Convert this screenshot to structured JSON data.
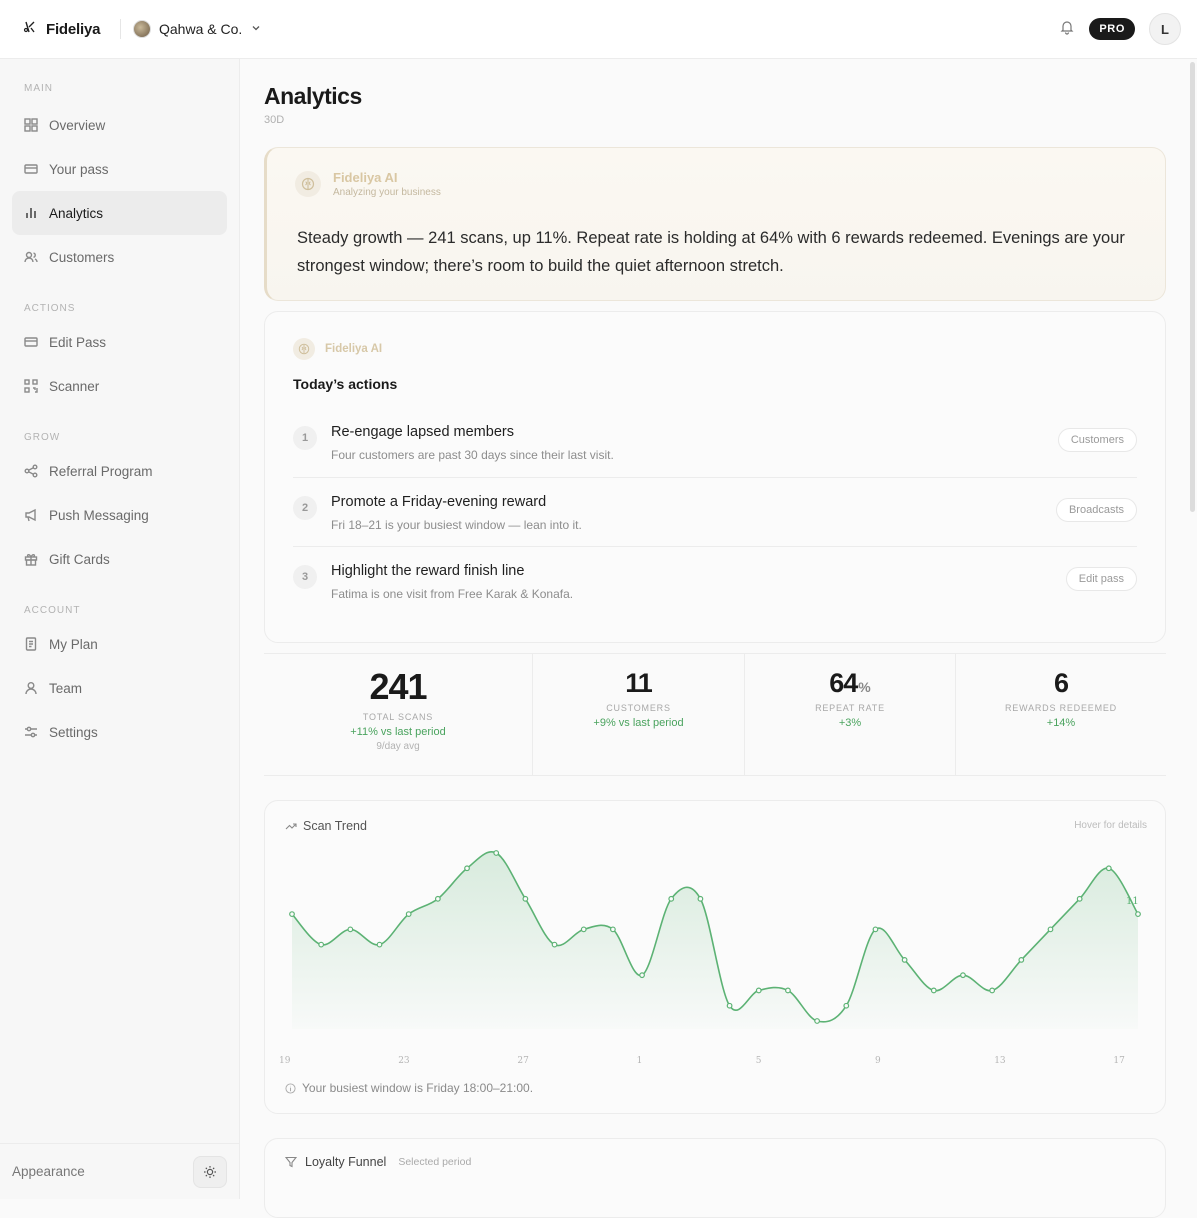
{
  "brand": {
    "name": "Fideliya",
    "org": "Qahwa & Co.",
    "plan_badge": "PRO",
    "user_initial": "L"
  },
  "sidebar": {
    "sections": [
      {
        "label": "MAIN",
        "items": [
          {
            "label": "Overview",
            "icon": "grid-icon"
          },
          {
            "label": "Your pass",
            "icon": "card-icon"
          },
          {
            "label": "Analytics",
            "icon": "bar-chart-icon",
            "active": true
          },
          {
            "label": "Customers",
            "icon": "users-icon"
          }
        ]
      },
      {
        "label": "ACTIONS",
        "items": [
          {
            "label": "Edit Pass",
            "icon": "card-icon"
          },
          {
            "label": "Scanner",
            "icon": "qr-icon"
          }
        ]
      },
      {
        "label": "GROW",
        "items": [
          {
            "label": "Referral Program",
            "icon": "share-icon"
          },
          {
            "label": "Push Messaging",
            "icon": "megaphone-icon"
          },
          {
            "label": "Gift Cards",
            "icon": "gift-icon"
          }
        ]
      },
      {
        "label": "ACCOUNT",
        "items": [
          {
            "label": "My Plan",
            "icon": "receipt-icon"
          },
          {
            "label": "Team",
            "icon": "user-icon"
          },
          {
            "label": "Settings",
            "icon": "sliders-icon"
          }
        ]
      }
    ],
    "appearance_label": "Appearance"
  },
  "page": {
    "title": "Analytics",
    "period": "30D"
  },
  "ai_summary": {
    "name": "Fideliya AI",
    "status": "Analyzing your business",
    "text": "Steady growth — 241 scans, up 11%. Repeat rate is holding at 64% with 6 rewards redeemed. Evenings are your strongest window; there’s room to build the quiet afternoon stretch."
  },
  "actions": {
    "brand": "Fideliya AI",
    "title": "Today’s actions",
    "items": [
      {
        "num": "1",
        "title": "Re-engage lapsed members",
        "desc": "Four customers are past 30 days since their last visit.",
        "link": "Customers"
      },
      {
        "num": "2",
        "title": "Promote a Friday-evening reward",
        "desc": "Fri 18–21 is your busiest window — lean into it.",
        "link": "Broadcasts"
      },
      {
        "num": "3",
        "title": "Highlight the reward finish line",
        "desc": "Fatima is one visit from Free Karak & Konafa.",
        "link": "Edit pass"
      }
    ]
  },
  "kpis": {
    "scans": {
      "value": "241",
      "label": "TOTAL SCANS",
      "delta": "+11% vs last period",
      "avg": "9/day avg"
    },
    "customers": {
      "value": "11",
      "label": "CUSTOMERS",
      "delta": "+9% vs last period"
    },
    "repeat": {
      "value": "64",
      "unit": "%",
      "label": "REPEAT RATE",
      "delta": "+3%"
    },
    "rewards": {
      "value": "6",
      "label": "REWARDS REDEEMED",
      "delta": "+14%"
    }
  },
  "trend": {
    "title": "Scan Trend",
    "hint": "Hover for details",
    "footer": "Your busiest window is Friday 18:00–21:00.",
    "last_label": "11",
    "accent": "#5cb274"
  },
  "chart_data": {
    "type": "area",
    "title": "Scan Trend",
    "x_ticks": [
      "19",
      "23",
      "27",
      "1",
      "5",
      "9",
      "13",
      "17"
    ],
    "values": [
      9,
      7,
      8,
      7,
      9,
      10,
      12,
      13,
      10,
      7,
      8,
      8,
      5,
      10,
      10,
      3,
      4,
      4,
      2,
      3,
      8,
      6,
      4,
      5,
      4,
      6,
      8,
      10,
      12,
      9
    ],
    "grid": false
  },
  "funnel": {
    "title": "Loyalty Funnel",
    "sub": "Selected period"
  }
}
